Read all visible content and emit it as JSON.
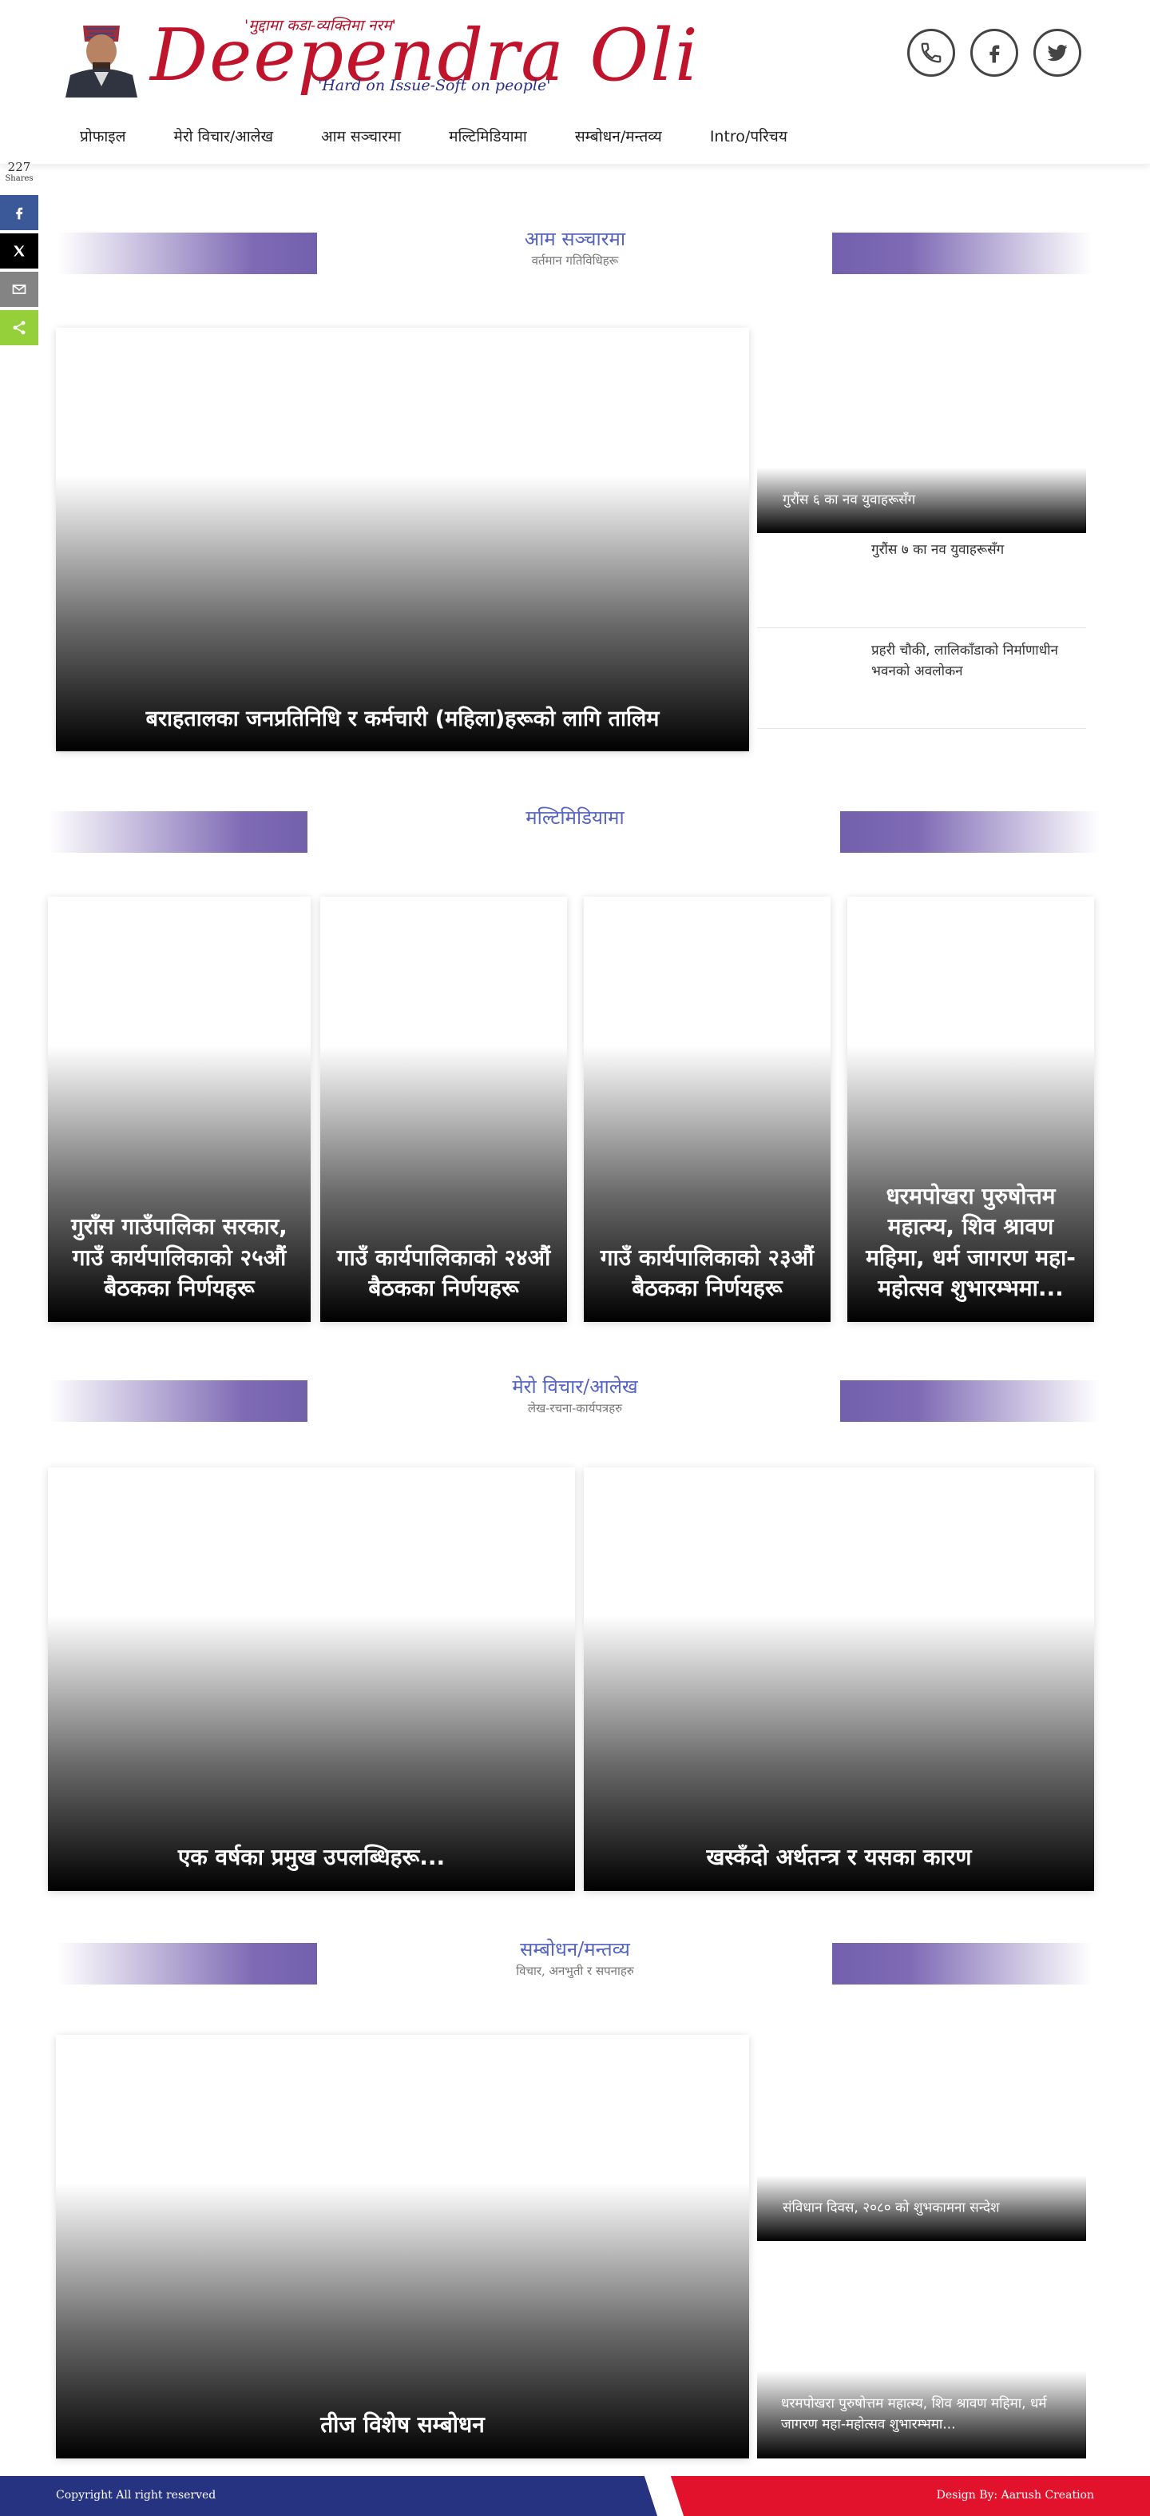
{
  "header": {
    "tagline_top": "'मुद्दामा कडा-व्यक्तिमा नरम'",
    "brand": "Deependra Oli",
    "tagline_bottom": "'Hard on Issue-Soft on people'",
    "social": [
      {
        "icon": "phone-icon"
      },
      {
        "icon": "facebook-icon"
      },
      {
        "icon": "twitter-icon"
      }
    ]
  },
  "nav": {
    "items": [
      {
        "label": "प्रोफाइल"
      },
      {
        "label": "मेरो विचार/आलेख"
      },
      {
        "label": "आम सञ्चारमा"
      },
      {
        "label": "मल्टिमिडियामा"
      },
      {
        "label": "सम्बोधन/मन्तव्य"
      },
      {
        "label": "Intro/परिचय"
      }
    ]
  },
  "share": {
    "count": "227",
    "label": "Shares",
    "buttons": [
      {
        "icon": "facebook-icon",
        "color": "#3b5998"
      },
      {
        "icon": "x-icon",
        "color": "#000000"
      },
      {
        "icon": "email-icon",
        "color": "#848484"
      },
      {
        "icon": "share-icon",
        "color": "#95d03a"
      }
    ]
  },
  "sections": {
    "media": {
      "title": "आम सञ्चारमा",
      "subtitle": "वर्तमान गतिविधिहरू",
      "main_caption": "बराहतालका जनप्रतिनिधि र कर्मचारी (महिला)हरूको लागि तालिम",
      "side_feature": "गुरौंस ६ का नव युवाहरूसँग",
      "side_items": [
        "गुरौंस ७ का नव युवाहरूसँग",
        "प्रहरी चौकी, लालिकाँडाको निर्माणाधीन भवनको अवलोकन"
      ]
    },
    "multimedia": {
      "title": "मल्टिमिडियामा",
      "cards": [
        "गुराँस गाउँपालिका सरकार, गाउँ कार्यपालिकाको २५औं बैठकका निर्णयहरू",
        "गाउँ कार्यपालिकाको २४औं बैठकका निर्णयहरू",
        "गाउँ कार्यपालिकाको २३औं बैठकका निर्णयहरू",
        "धरमपोखरा पुरुषोत्तम महात्म्य, शिव श्रावण महिमा, धर्म जागरण महा-महोत्सव शुभारम्भमा..."
      ]
    },
    "articles": {
      "title": "मेरो विचार/आलेख",
      "subtitle": "लेख-रचना-कार्यपत्रहरु",
      "cards": [
        "एक वर्षका प्रमुख उपलब्धिहरू...",
        "खस्कँदो अर्थतन्त्र र यसका कारण"
      ]
    },
    "speeches": {
      "title": "सम्बोधन/मन्तव्य",
      "subtitle": "विचार, अनभुती र सपनाहरु",
      "main_caption": "तीज विशेष सम्बोधन",
      "side_feature_1": "संविधान दिवस, २०८० को शुभकामना सन्देश",
      "side_feature_2": "धरमपोखरा पुरुषोत्तम महात्म्य, शिव श्रावण महिमा, धर्म जागरण महा-महोत्सव शुभारम्भमा..."
    }
  },
  "footer": {
    "copyright": "Copyright All right reserved",
    "design": "Design By: Aarush Creation",
    "colors": {
      "blue": "#253380",
      "red": "#e3122c"
    }
  }
}
